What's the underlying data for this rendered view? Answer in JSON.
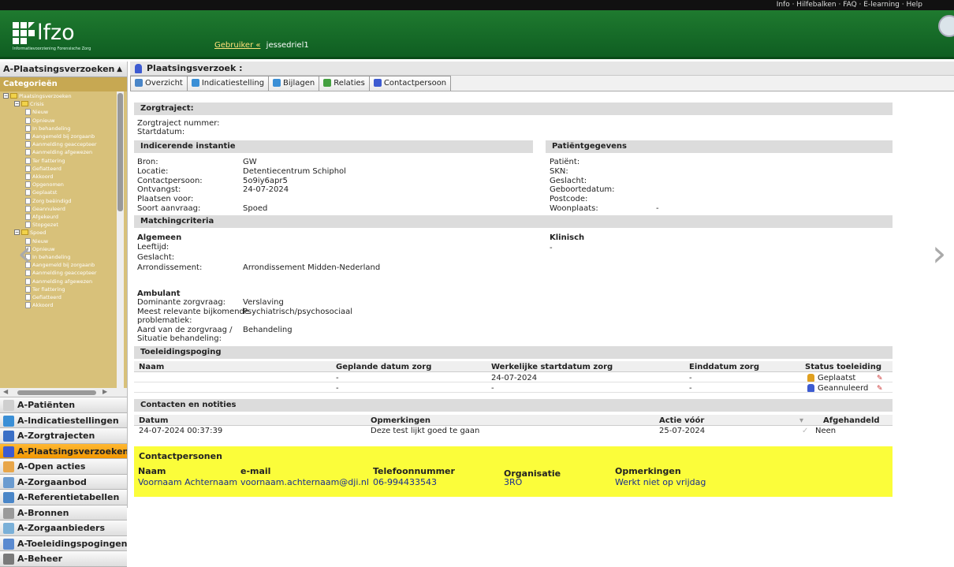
{
  "topbar": {
    "links": "Info · Hilfebalken · FAQ · E-learning · Help"
  },
  "header": {
    "logo_text": "lfzo",
    "logo_sub": "Informatievoorziening Forensische Zorg",
    "user_link": "Gebruiker «",
    "user_name": "jessedriel1"
  },
  "sidebar": {
    "title": "A-Plaatsingsverzoeken",
    "categories_label": "Categorieën",
    "tree": [
      {
        "label": "Plaatsingsverzoeken",
        "level": 0,
        "kind": "folder"
      },
      {
        "label": "Crisis",
        "level": 1,
        "kind": "folder"
      },
      {
        "label": "Nieuw",
        "level": 2,
        "kind": "file"
      },
      {
        "label": "Opnieuw",
        "level": 2,
        "kind": "file"
      },
      {
        "label": "In behandeling",
        "level": 2,
        "kind": "file"
      },
      {
        "label": "Aangemeld bij zorgaanb",
        "level": 2,
        "kind": "file"
      },
      {
        "label": "Aanmelding geaccepteer",
        "level": 2,
        "kind": "file"
      },
      {
        "label": "Aanmelding afgewezen",
        "level": 2,
        "kind": "file"
      },
      {
        "label": "Ter fiattering",
        "level": 2,
        "kind": "file"
      },
      {
        "label": "Gefiatteerd",
        "level": 2,
        "kind": "file"
      },
      {
        "label": "Akkoord",
        "level": 2,
        "kind": "file"
      },
      {
        "label": "Opgenomen",
        "level": 2,
        "kind": "file"
      },
      {
        "label": "Geplaatst",
        "level": 2,
        "kind": "file"
      },
      {
        "label": "Zorg beëindigd",
        "level": 2,
        "kind": "file"
      },
      {
        "label": "Geannuleerd",
        "level": 2,
        "kind": "file"
      },
      {
        "label": "Afgekeurd",
        "level": 2,
        "kind": "file"
      },
      {
        "label": "Stopgezet",
        "level": 2,
        "kind": "file"
      },
      {
        "label": "Spoed",
        "level": 1,
        "kind": "folder"
      },
      {
        "label": "Nieuw",
        "level": 2,
        "kind": "file"
      },
      {
        "label": "Opnieuw",
        "level": 2,
        "kind": "file"
      },
      {
        "label": "In behandeling",
        "level": 2,
        "kind": "file"
      },
      {
        "label": "Aangemeld bij zorgaanb",
        "level": 2,
        "kind": "file"
      },
      {
        "label": "Aanmelding geaccepteer",
        "level": 2,
        "kind": "file"
      },
      {
        "label": "Aanmelding afgewezen",
        "level": 2,
        "kind": "file"
      },
      {
        "label": "Ter fiattering",
        "level": 2,
        "kind": "file"
      },
      {
        "label": "Gefiatteerd",
        "level": 2,
        "kind": "file"
      },
      {
        "label": "Akkoord",
        "level": 2,
        "kind": "file"
      }
    ],
    "nav": [
      {
        "label": "A-Patiënten",
        "icon": "patient-icon",
        "color": "#cfcfcf"
      },
      {
        "label": "A-Indicatiestellingen",
        "icon": "indication-icon",
        "color": "#3a8fd6"
      },
      {
        "label": "A-Zorgtrajecten",
        "icon": "care-path-icon",
        "color": "#3a6fc6"
      },
      {
        "label": "A-Plaatsingsverzoeken",
        "icon": "placement-icon",
        "color": "#3d5bd1",
        "active": true
      },
      {
        "label": "A-Open acties",
        "icon": "open-actions-icon",
        "color": "#e8a64a"
      },
      {
        "label": "A-Zorgaanbod",
        "icon": "care-offer-icon",
        "color": "#6a9bd0"
      },
      {
        "label": "A-Referentietabellen",
        "icon": "reference-table-icon",
        "color": "#4a86c8"
      },
      {
        "label": "A-Bronnen",
        "icon": "sources-icon",
        "color": "#9a9a9a"
      },
      {
        "label": "A-Zorgaanbieders",
        "icon": "providers-icon",
        "color": "#7ab0d8"
      },
      {
        "label": "A-Toeleidingspogingen",
        "icon": "referral-attempts-icon",
        "color": "#5a8ad0"
      },
      {
        "label": "A-Beheer",
        "icon": "admin-icon",
        "color": "#7a7a7a"
      }
    ]
  },
  "main": {
    "title": "Plaatsingsverzoek :",
    "tabs": [
      {
        "label": "Overzicht",
        "color": "#4a86c8"
      },
      {
        "label": "Indicatiestelling",
        "color": "#3a8fd6"
      },
      {
        "label": "Bijlagen",
        "color": "#3a8fd6"
      },
      {
        "label": "Relaties",
        "color": "#44a040"
      },
      {
        "label": "Contactpersoon",
        "color": "#3d5bd1"
      }
    ],
    "zorgtraject": {
      "header": "Zorgtraject:",
      "nummer_label": "Zorgtraject nummer:",
      "startdatum_label": "Startdatum:"
    },
    "indicerende": {
      "header": "Indicerende instantie",
      "labels": [
        "Bron:",
        "Locatie:",
        "Contactpersoon:",
        "Ontvangst:",
        "Plaatsen voor:",
        "Soort aanvraag:"
      ],
      "values": [
        "GW",
        "Detentiecentrum Schiphol",
        "5o9iy6apr5",
        "24-07-2024",
        "",
        "Spoed"
      ]
    },
    "patient": {
      "header": "Patiëntgegevens",
      "labels": [
        "Patiënt:",
        "SKN:",
        "Geslacht:",
        "Geboortedatum:",
        "Postcode:",
        "Woonplaats:"
      ],
      "woonplaats_value": "-"
    },
    "matching": {
      "header": "Matchingcriteria",
      "algemeen": "Algemeen",
      "leeftijd": "Leeftijd:",
      "geslacht": "Geslacht:",
      "arrondissement_label": "Arrondissement:",
      "arrondissement_value": "Arrondissement Midden-Nederland",
      "klinisch": "Klinisch",
      "klinisch_value": "-",
      "ambulant": "Ambulant",
      "dominante_label": "Dominante zorgvraag:",
      "dominante_value": "Verslaving",
      "relevant_label1": "Meest relevante bijkomende",
      "relevant_label2": "problematiek:",
      "relevant_value": "Psychiatrisch/psychosociaal",
      "aard_label1": "Aard van de zorgvraag /",
      "aard_label2": "Situatie behandeling:",
      "aard_value": "Behandeling"
    },
    "toeleiding": {
      "header": "Toeleidingspoging",
      "columns": [
        "Naam",
        "Geplande datum zorg",
        "Werkelijke startdatum zorg",
        "Einddatum zorg",
        "Status toeleiding"
      ],
      "rows": [
        {
          "naam": "",
          "gepland": "-",
          "werkelijk": "24-07-2024",
          "eind": "-",
          "status": "Geplaatst",
          "status_color": "#e0a020"
        },
        {
          "naam": "",
          "gepland": "-",
          "werkelijk": "-",
          "eind": "-",
          "status": "Geannuleerd",
          "status_color": "#3d5bd1"
        }
      ]
    },
    "contacten": {
      "header": "Contacten en notities",
      "columns": [
        "Datum",
        "Opmerkingen",
        "Actie vóór",
        "Afgehandeld"
      ],
      "rows": [
        {
          "datum": "24-07-2024 00:37:39",
          "opm": "Deze test lijkt goed te gaan",
          "actie": "25-07-2024",
          "afgehandeld": "Neen"
        }
      ]
    },
    "contactpersonen": {
      "header": "Contactpersonen",
      "columns": [
        "Naam",
        "e-mail",
        "Telefoonnummer",
        "Organisatie",
        "Opmerkingen"
      ],
      "rows": [
        {
          "naam": "Voornaam Achternaam",
          "email": "voornaam.achternaam@dji.nl",
          "tel": "06-994433543",
          "org": "3RO",
          "opm": "Werkt niet op vrijdag"
        }
      ]
    }
  }
}
